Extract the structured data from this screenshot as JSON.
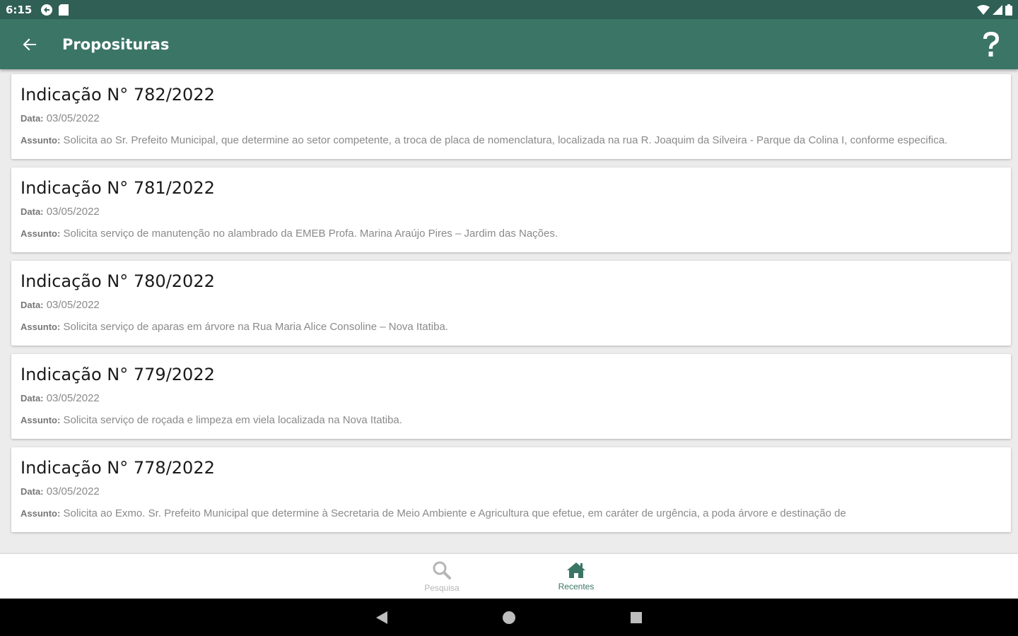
{
  "status_bar": {
    "time": "6:15"
  },
  "app_bar": {
    "title": "Proposituras"
  },
  "items": [
    {
      "title": "Indicação N° 782/2022",
      "date_label": "Data:",
      "date": "03/05/2022",
      "subject_label": "Assunto:",
      "subject": "Solicita ao Sr. Prefeito Municipal, que determine ao setor competente, a troca de placa de nomenclatura, localizada na rua R. Joaquim da Silveira - Parque da Colina I, conforme especifica."
    },
    {
      "title": "Indicação N° 781/2022",
      "date_label": "Data:",
      "date": "03/05/2022",
      "subject_label": "Assunto:",
      "subject": "Solicita serviço de manutenção no alambrado da EMEB Profa. Marina Araújo Pires – Jardim das Nações."
    },
    {
      "title": "Indicação N° 780/2022",
      "date_label": "Data:",
      "date": "03/05/2022",
      "subject_label": "Assunto:",
      "subject": "Solicita serviço de aparas em árvore na Rua Maria Alice Consoline – Nova Itatiba."
    },
    {
      "title": "Indicação N° 779/2022",
      "date_label": "Data:",
      "date": "03/05/2022",
      "subject_label": "Assunto:",
      "subject": "Solicita serviço de roçada e limpeza em viela localizada na Nova Itatiba."
    },
    {
      "title": "Indicação N° 778/2022",
      "date_label": "Data:",
      "date": "03/05/2022",
      "subject_label": "Assunto:",
      "subject": "Solicita ao Exmo. Sr. Prefeito Municipal que determine à Secretaria de Meio Ambiente e Agricultura que efetue, em caráter de urgência, a poda árvore e destinação de"
    }
  ],
  "bottom_nav": {
    "search_label": "Pesquisa",
    "recent_label": "Recentes"
  },
  "colors": {
    "status_bar": "#2f5f55",
    "app_bar": "#3b7565",
    "accent": "#3b7565"
  }
}
